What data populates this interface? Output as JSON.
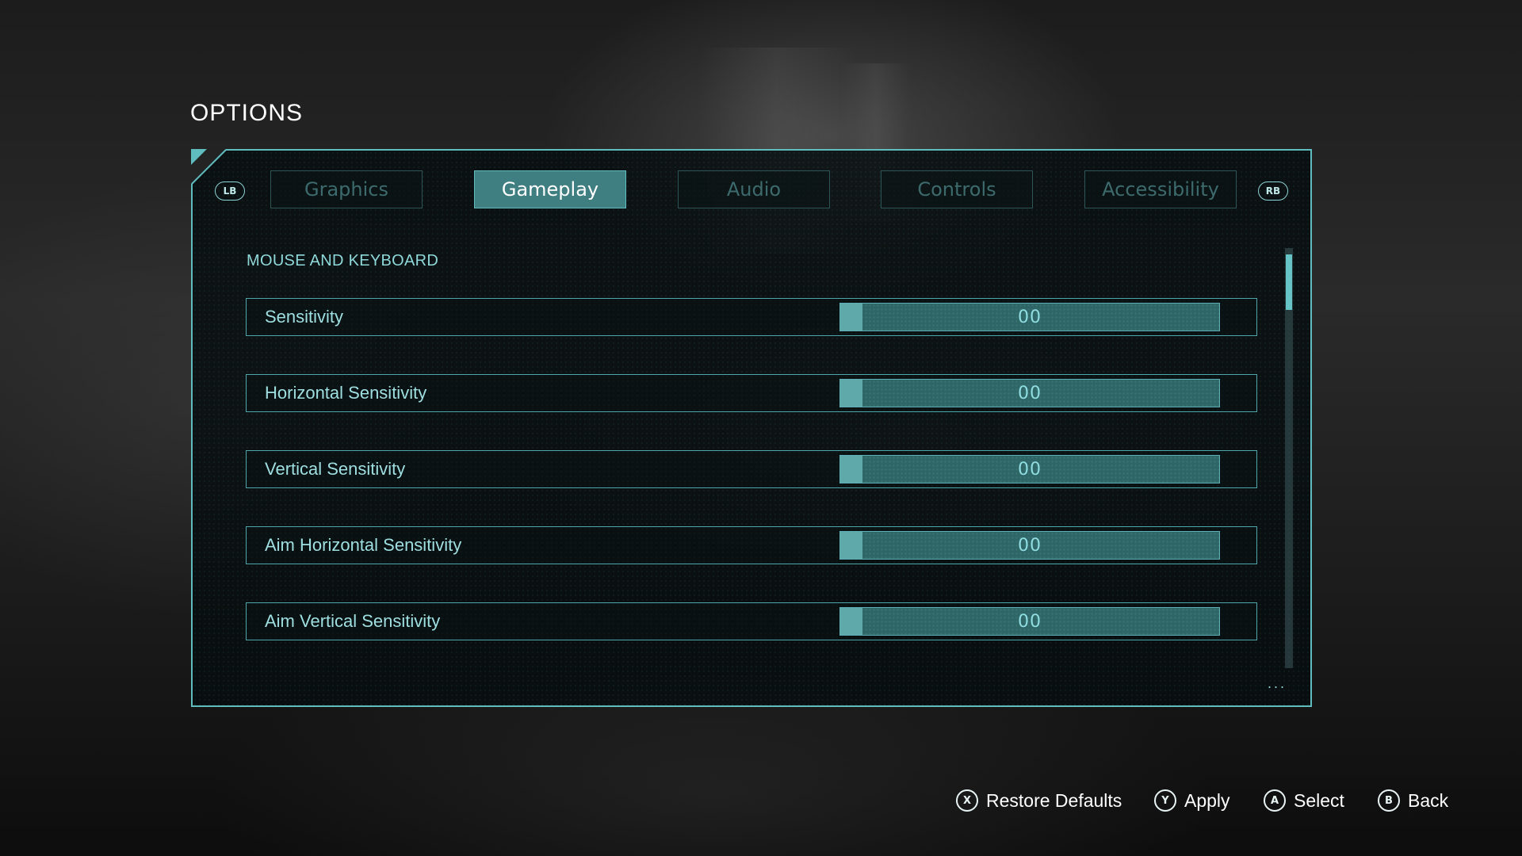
{
  "page": {
    "title": "OPTIONS"
  },
  "tabs": {
    "left_shoulder": "LB",
    "right_shoulder": "RB",
    "items": [
      {
        "label": "Graphics",
        "active": false
      },
      {
        "label": "Gameplay",
        "active": true
      },
      {
        "label": "Audio",
        "active": false
      },
      {
        "label": "Controls",
        "active": false
      },
      {
        "label": "Accessibility",
        "active": false
      }
    ]
  },
  "section": {
    "title": "MOUSE AND KEYBOARD"
  },
  "settings": [
    {
      "label": "Sensitivity",
      "value": "00"
    },
    {
      "label": "Horizontal Sensitivity",
      "value": "00"
    },
    {
      "label": "Vertical Sensitivity",
      "value": "00"
    },
    {
      "label": "Aim Horizontal Sensitivity",
      "value": "00"
    },
    {
      "label": "Aim Vertical Sensitivity",
      "value": "00"
    }
  ],
  "more_indicator": "...",
  "footer": {
    "restore": {
      "key": "X",
      "label": "Restore Defaults"
    },
    "apply": {
      "key": "Y",
      "label": "Apply"
    },
    "select": {
      "key": "A",
      "label": "Select"
    },
    "back": {
      "key": "B",
      "label": "Back"
    }
  },
  "colors": {
    "accent": "#5fbcbf",
    "active_tab": "#3f7f81",
    "slider_bg": "#2e6668",
    "text_light": "#9fdfe1"
  }
}
